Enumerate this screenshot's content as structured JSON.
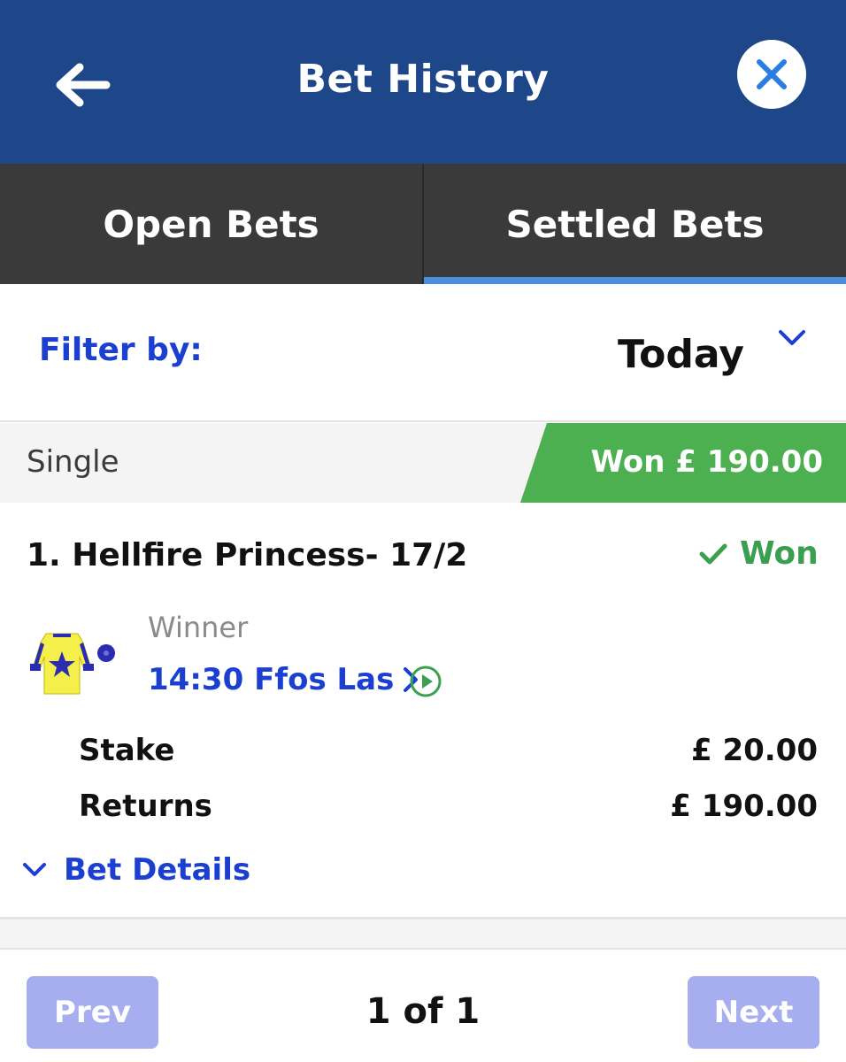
{
  "header": {
    "title": "Bet History",
    "back_icon": "arrow-left-icon",
    "close_icon": "close-icon",
    "bg_color": "#1d4789"
  },
  "tabs": [
    {
      "label": "Open Bets",
      "active": false
    },
    {
      "label": "Settled Bets",
      "active": true
    }
  ],
  "filter": {
    "label": "Filter by:",
    "value": "Today",
    "icon": "chevron-down-icon"
  },
  "bet": {
    "type": "Single",
    "result_badge": "Won £ 190.00",
    "selection": "1. Hellfire Princess- 17/2",
    "status": "Won",
    "status_icon": "check-icon",
    "market": "Winner",
    "race": "14:30 Ffos Las",
    "race_icon": "chevron-right-icon",
    "play_icon": "play-circle-icon",
    "silks_icon": "jockey-silks-icon",
    "stake_label": "Stake",
    "stake_value": "£ 20.00",
    "returns_label": "Returns",
    "returns_value": "£ 190.00",
    "details_label": "Bet Details",
    "details_icon": "chevron-down-icon",
    "won_color": "#4caf50"
  },
  "pagination": {
    "prev_label": "Prev",
    "next_label": "Next",
    "page_info": "1 of 1"
  }
}
